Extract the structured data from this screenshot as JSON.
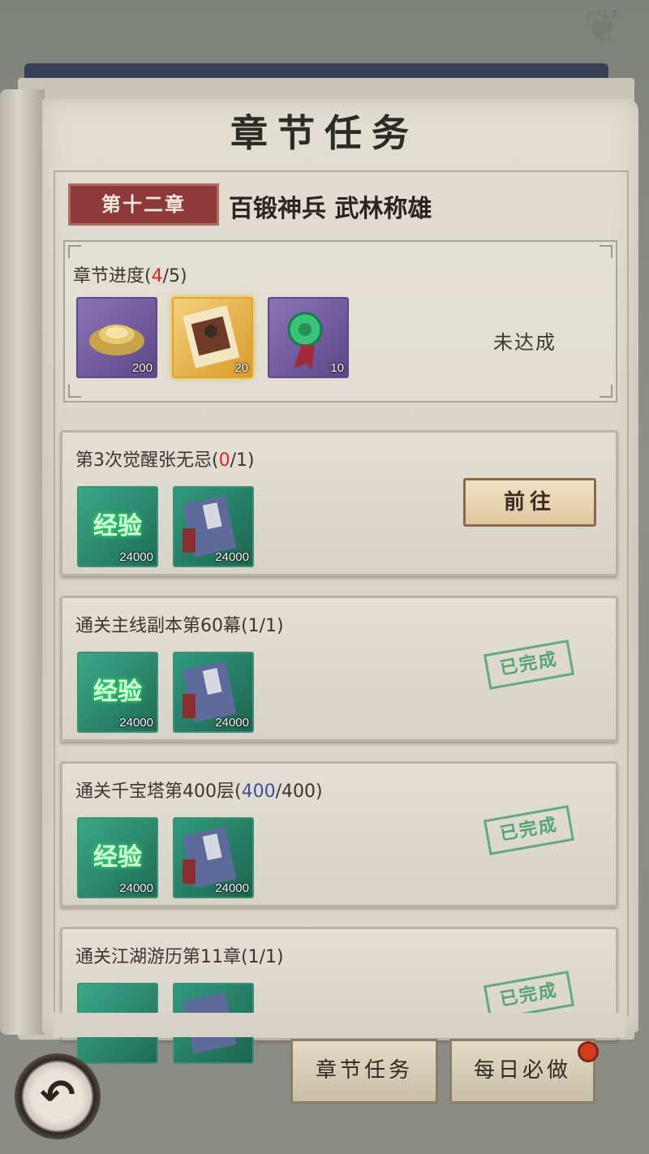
{
  "title": "章节任务",
  "chapter": {
    "badge": "第十二章",
    "name": "百锻神兵 武林称雄",
    "progress_label": "章节进度(",
    "progress_done": "4",
    "progress_total": "/5)",
    "status": "未达成",
    "rewards": [
      {
        "icon": "gold-ingot-icon",
        "count": "200"
      },
      {
        "icon": "golden-card-icon",
        "count": "20"
      },
      {
        "icon": "jade-pendant-icon",
        "count": "10"
      }
    ]
  },
  "tasks": [
    {
      "title_pre": "第3次觉醒张无忌(",
      "progress": "0",
      "title_post": "/1)",
      "action": "前往",
      "rewards": [
        {
          "label": "经验",
          "count": "24000"
        },
        {
          "icon": "book-icon",
          "count": "24000"
        }
      ]
    },
    {
      "title": "通关主线副本第60幕(1/1)",
      "stamp": "已完成",
      "rewards": [
        {
          "label": "经验",
          "count": "24000"
        },
        {
          "icon": "book-icon",
          "count": "24000"
        }
      ]
    },
    {
      "title_pre": "通关千宝塔第400层(",
      "progress": "400",
      "title_post": "/400)",
      "stamp": "已完成",
      "rewards": [
        {
          "label": "经验",
          "count": "24000"
        },
        {
          "icon": "book-icon",
          "count": "24000"
        }
      ]
    },
    {
      "title": "通关江湖游历第11章(1/1)",
      "stamp": "已完成"
    }
  ],
  "tabs": [
    "章节任务",
    "每日必做"
  ],
  "back_icon": "back-arrow-icon"
}
